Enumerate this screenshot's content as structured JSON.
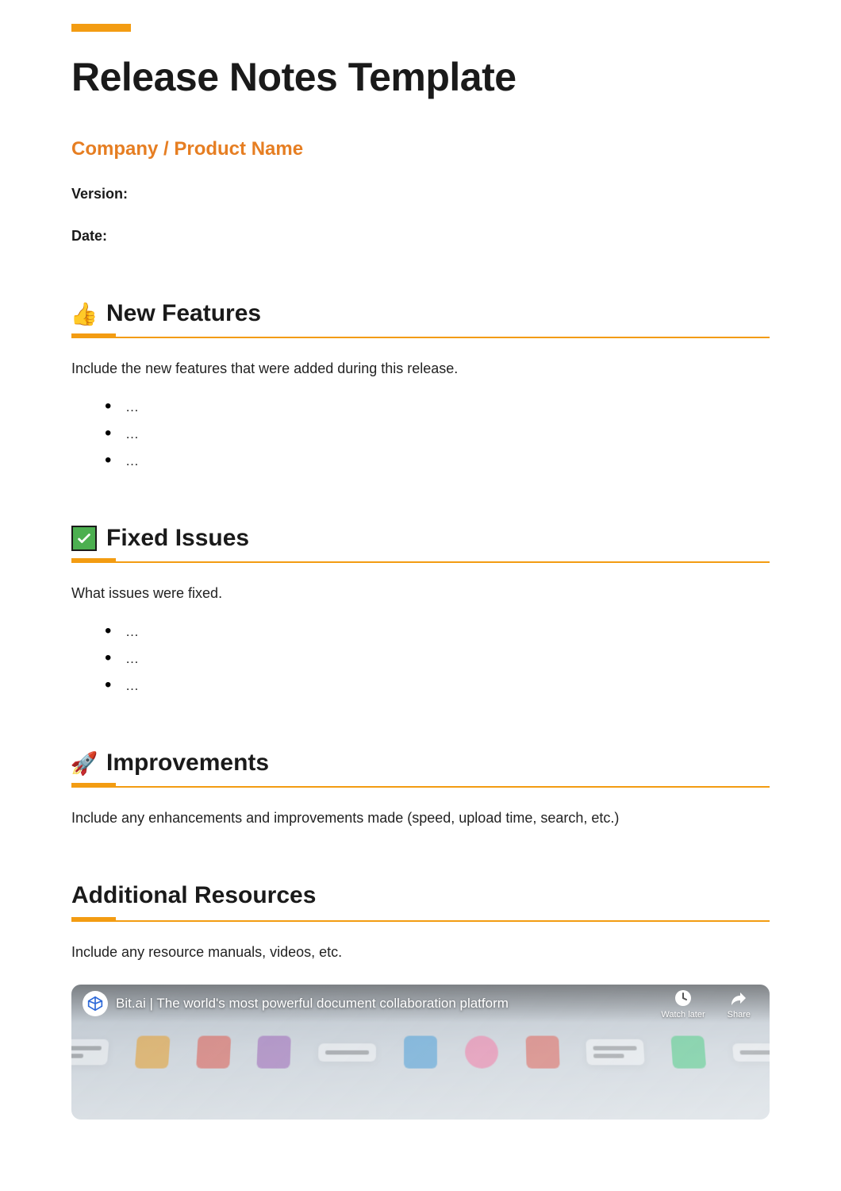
{
  "header": {
    "title": "Release Notes Template",
    "subtitle": "Company / Product Name",
    "version_label": "Version:",
    "date_label": "Date:"
  },
  "sections": {
    "new_features": {
      "icon": "thumbs-up",
      "title": "New Features",
      "description": "Include the new features that were added during this release.",
      "items": [
        "…",
        "…",
        "…"
      ]
    },
    "fixed_issues": {
      "icon": "checkmark",
      "title": "Fixed Issues",
      "description": "What issues were fixed.",
      "items": [
        "…",
        "…",
        "…"
      ]
    },
    "improvements": {
      "icon": "rocket",
      "title": "Improvements",
      "description": "Include any enhancements and improvements made (speed, upload time, search, etc.)"
    },
    "resources": {
      "title": "Additional Resources",
      "description": "Include any resource manuals, videos, etc."
    }
  },
  "video": {
    "title": "Bit.ai | The world's most powerful document collaboration platform",
    "watch_later_label": "Watch later",
    "share_label": "Share"
  },
  "colors": {
    "accent": "#f39c12",
    "subtitle": "#e67e22"
  }
}
